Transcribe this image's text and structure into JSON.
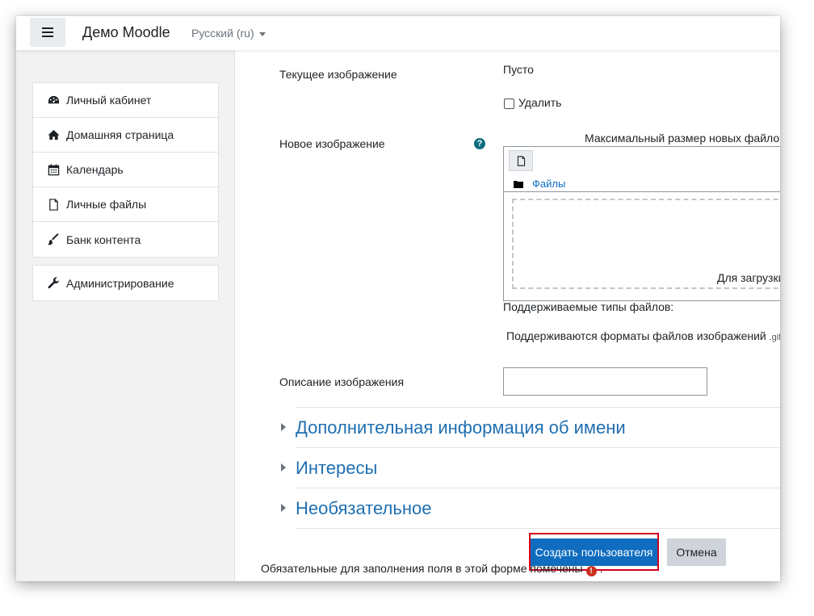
{
  "navbar": {
    "site_name": "Демо Moodle",
    "language": "Русский (ru)"
  },
  "drawer": {
    "items": [
      {
        "label": "Личный кабинет",
        "icon": "dashboard-icon"
      },
      {
        "label": "Домашняя страница",
        "icon": "home-icon"
      },
      {
        "label": "Календарь",
        "icon": "calendar-icon"
      },
      {
        "label": "Личные файлы",
        "icon": "file-icon"
      },
      {
        "label": "Банк контента",
        "icon": "brush-icon"
      }
    ],
    "admin": {
      "label": "Администрирование",
      "icon": "wrench-icon"
    }
  },
  "form": {
    "current_image_label": "Текущее изображение",
    "current_image_value": "Пусто",
    "delete_label": "Удалить",
    "new_image_label": "Новое изображение",
    "max_size_text": "Максимальный размер новых файлов",
    "files_path": "Файлы",
    "drop_text": "Для загрузки",
    "supported_types_label": "Поддерживаемые типы файлов:",
    "supported_formats": "Поддерживаются форматы файлов изображений",
    "supported_formats_ext": ".gif",
    "image_description_label": "Описание изображения",
    "image_description_value": ""
  },
  "sections": [
    {
      "title": "Дополнительная информация об имени"
    },
    {
      "title": "Интересы"
    },
    {
      "title": "Необязательное"
    }
  ],
  "buttons": {
    "submit": "Создать пользователя",
    "cancel": "Отмена"
  },
  "footer_note": {
    "text": "Обязательные для заполнения поля в этой форме помечены",
    "suffix": "."
  },
  "colors": {
    "primary": "#0f6cbf",
    "link": "#1f6fb2",
    "highlight": "#d0021b",
    "required": "#ca3120"
  }
}
